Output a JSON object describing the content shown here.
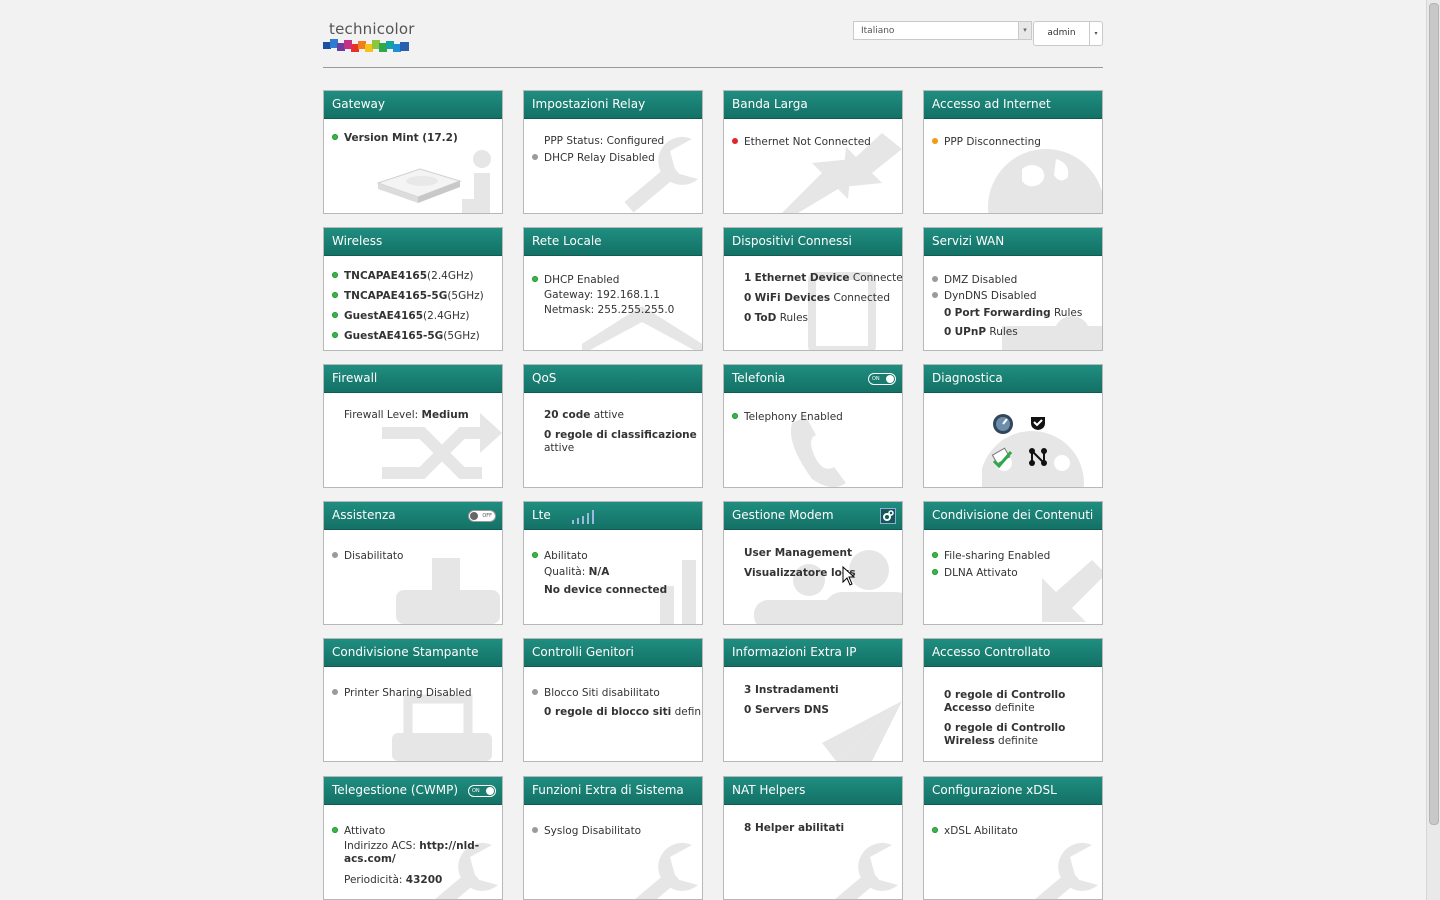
{
  "header": {
    "logo_text": "technicolor",
    "language": "Italiano",
    "user": "admin"
  },
  "cards": {
    "gateway": {
      "title": "Gateway",
      "version": "Version Mint (17.2)"
    },
    "relay": {
      "title": "Impostazioni Relay",
      "ppp_status": "PPP Status: Configured",
      "dhcp_relay": "DHCP Relay Disabled"
    },
    "broadband": {
      "title": "Banda Larga",
      "status": "Ethernet Not Connected"
    },
    "internet": {
      "title": "Accesso ad Internet",
      "status": "PPP Disconnecting"
    },
    "wireless": {
      "title": "Wireless",
      "networks": [
        {
          "ssid": "TNCAPAE4165",
          "band": "(2.4GHz)"
        },
        {
          "ssid": "TNCAPAE4165-5G",
          "band": "(5GHz)"
        },
        {
          "ssid": "GuestAE4165",
          "band": "(2.4GHz)"
        },
        {
          "ssid": "GuestAE4165-5G",
          "band": "(5GHz)"
        }
      ]
    },
    "lan": {
      "title": "Rete Locale",
      "dhcp": "DHCP Enabled",
      "gateway": "Gateway: 192.168.1.1",
      "netmask": "Netmask: 255.255.255.0"
    },
    "devices": {
      "title": "Dispositivi Connessi",
      "eth_count": "1",
      "eth_label": "Ethernet Device",
      "eth_suffix": "Connected",
      "wifi_count": "0",
      "wifi_label": "WiFi Devices",
      "wifi_suffix": "Connected",
      "tod_count": "0",
      "tod_label": "ToD",
      "tod_suffix": "Rules"
    },
    "wan": {
      "title": "Servizi WAN",
      "dmz": "DMZ Disabled",
      "dyndns": "DynDNS Disabled",
      "pf_count": "0",
      "pf_label": "Port Forwarding",
      "pf_suffix": "Rules",
      "upnp_count": "0",
      "upnp_label": "UPnP",
      "upnp_suffix": "Rules"
    },
    "firewall": {
      "title": "Firewall",
      "level_label": "Firewall Level:",
      "level": "Medium"
    },
    "qos": {
      "title": "QoS",
      "codes": "20 code",
      "codes_suffix": "attive",
      "rules": "0 regole di classificazione",
      "rules_suffix": "attive"
    },
    "telephony": {
      "title": "Telefonia",
      "toggle": "ON",
      "status": "Telephony Enabled"
    },
    "diagnostics": {
      "title": "Diagnostica"
    },
    "assistance": {
      "title": "Assistenza",
      "toggle": "OFF",
      "status": "Disabilitato"
    },
    "lte": {
      "title": "Lte",
      "status": "Abilitato",
      "quality_label": "Qualità:",
      "quality": "N/A",
      "devices": "No device connected"
    },
    "modem": {
      "title": "Gestione Modem",
      "user_mgmt": "User Management",
      "logs": "Visualizzatore logs"
    },
    "content_sharing": {
      "title": "Condivisione dei Contenuti",
      "filesharing": "File-sharing Enabled",
      "dlna": "DLNA Attivato"
    },
    "printer": {
      "title": "Condivisione Stampante",
      "status": "Printer Sharing Disabled"
    },
    "parental": {
      "title": "Controlli Genitori",
      "block": "Blocco Siti disabilitato",
      "rules": "0 regole di blocco siti",
      "rules_suffix": "definite"
    },
    "extra_ip": {
      "title": "Informazioni Extra IP",
      "routes": "3 Instradamenti",
      "dns": "0 Servers DNS"
    },
    "access_control": {
      "title": "Accesso Controllato",
      "acl": "0 regole di Controllo Accesso",
      "acl_suffix": "definite",
      "wireless": "0 regole di Controllo Wireless",
      "wireless_suffix": "definite"
    },
    "cwmp": {
      "title": "Telegestione (CWMP)",
      "toggle": "ON",
      "status": "Attivato",
      "acs_label": "Indirizzo ACS:",
      "acs": "http://nld-acs.com/",
      "period_label": "Periodicità:",
      "period": "43200"
    },
    "sysextra": {
      "title": "Funzioni Extra di Sistema",
      "syslog": "Syslog Disabilitato"
    },
    "nat": {
      "title": "NAT Helpers",
      "helpers": "8 Helper abilitati"
    },
    "xdsl": {
      "title": "Configurazione xDSL",
      "status": "xDSL Abilitato"
    }
  },
  "colors": {
    "header_green": "#1a7b6f",
    "ok": "#3ab54a",
    "error": "#e0262a",
    "warn": "#f39a14",
    "disabled": "#9a9a9a"
  }
}
